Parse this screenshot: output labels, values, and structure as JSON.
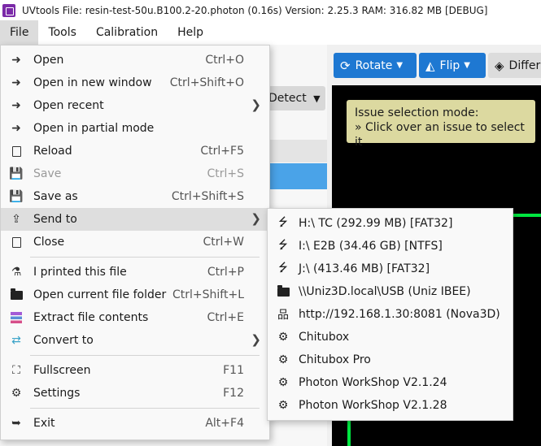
{
  "titlebar": {
    "text": "UVtools  File: resin-test-50u.B100.2-20.photon (0.16s)  Version: 2.25.3  RAM: 316.82 MB  [DEBUG]"
  },
  "menubar": {
    "items": [
      "File",
      "Tools",
      "Calibration",
      "Help"
    ]
  },
  "toolbar": {
    "rotate_label": "Rotate",
    "flip_label": "Flip",
    "diff_label": "Differ",
    "detect_label": "Detect"
  },
  "tooltip": {
    "line1": "Issue selection mode:",
    "line2": "» Click over an issue to select it"
  },
  "file_menu": {
    "items": [
      {
        "label": "Open",
        "shortcut": "Ctrl+O",
        "icon": "sign-in-icon"
      },
      {
        "label": "Open in new window",
        "shortcut": "Ctrl+Shift+O",
        "icon": "sign-in-icon"
      },
      {
        "label": "Open recent",
        "shortcut": "",
        "icon": "sign-in-icon"
      },
      {
        "label": "Open in partial mode",
        "shortcut": "",
        "icon": "sign-in-icon"
      },
      {
        "label": "Reload",
        "shortcut": "Ctrl+F5",
        "icon": "reload-file-icon"
      },
      {
        "label": "Save",
        "shortcut": "Ctrl+S",
        "icon": "save-icon"
      },
      {
        "label": "Save as",
        "shortcut": "Ctrl+Shift+S",
        "icon": "save-icon"
      },
      {
        "label": "Send to",
        "shortcut": "",
        "icon": "share-icon"
      },
      {
        "label": "Close",
        "shortcut": "Ctrl+W",
        "icon": "close-file-icon"
      },
      {
        "label": "I printed this file",
        "shortcut": "Ctrl+P",
        "icon": "flask-icon"
      },
      {
        "label": "Open current file folder",
        "shortcut": "Ctrl+Shift+L",
        "icon": "folder-open-icon"
      },
      {
        "label": "Extract file contents",
        "shortcut": "Ctrl+E",
        "icon": "layers-icon"
      },
      {
        "label": "Convert to",
        "shortcut": "",
        "icon": "convert-icon"
      },
      {
        "label": "Fullscreen",
        "shortcut": "F11",
        "icon": "fullscreen-icon"
      },
      {
        "label": "Settings",
        "shortcut": "F12",
        "icon": "gear-icon"
      },
      {
        "label": "Exit",
        "shortcut": "Alt+F4",
        "icon": "exit-icon"
      }
    ]
  },
  "send_to_menu": {
    "items": [
      {
        "label": "H:\\  TC  (292.99 MB) [FAT32]",
        "icon": "usb-icon"
      },
      {
        "label": "I:\\  E2B  (34.46 GB) [NTFS]",
        "icon": "usb-icon"
      },
      {
        "label": "J:\\  (413.46 MB) [FAT32]",
        "icon": "usb-icon"
      },
      {
        "label": "\\\\Uniz3D.local\\USB  (Uniz IBEE)",
        "icon": "folder-icon"
      },
      {
        "label": "http://192.168.1.30:8081  (Nova3D)",
        "icon": "network-icon"
      },
      {
        "label": "Chitubox",
        "icon": "gear-icon"
      },
      {
        "label": "Chitubox Pro",
        "icon": "gear-icon"
      },
      {
        "label": "Photon WorkShop V2.1.24",
        "icon": "gear-icon"
      },
      {
        "label": "Photon WorkShop V2.1.28",
        "icon": "gear-icon"
      }
    ]
  }
}
